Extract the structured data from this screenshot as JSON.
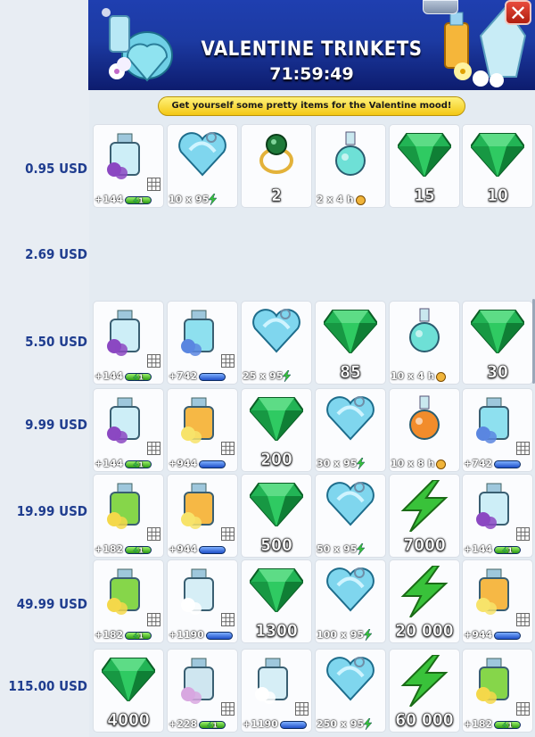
{
  "header": {
    "title": "VALENTINE TRINKETS",
    "timer": "71:59:49"
  },
  "banner": "Get yourself some pretty items for the Valentine mood!",
  "colors": {
    "header_blue": "#1f3fb0",
    "price_text": "#1f3d8f",
    "gem": "#22b455",
    "bolt": "#39c23a",
    "banner": "#f3c714"
  },
  "rows": [
    {
      "price": "0.95 USD",
      "items": [
        {
          "icon": "perfume-bouquet-icon",
          "label": "+144",
          "kind": "sub",
          "badge": "green",
          "badge_text": "1"
        },
        {
          "icon": "heart-bottle-icon",
          "label": "10 x 95",
          "kind": "sub-bolt"
        },
        {
          "icon": "emerald-ring-icon",
          "label": "2",
          "kind": "amt"
        },
        {
          "icon": "potion-flask-icon",
          "label": "2 x 4 h",
          "kind": "sub-clock"
        },
        {
          "icon": "emerald-gem-icon",
          "label": "15",
          "kind": "amt"
        },
        {
          "icon": "emerald-gem-icon",
          "label": "10",
          "kind": "amt"
        }
      ]
    },
    {
      "price": "2.69 USD",
      "items": []
    },
    {
      "price": "5.50 USD",
      "items": [
        {
          "icon": "perfume-bouquet-icon",
          "label": "+144",
          "kind": "sub",
          "badge": "green",
          "badge_text": "1"
        },
        {
          "icon": "heart-perfume-icon",
          "label": "+742",
          "kind": "sub",
          "badge": "blue"
        },
        {
          "icon": "heart-bottle-icon",
          "label": "25 x 95",
          "kind": "sub-bolt"
        },
        {
          "icon": "emerald-gem-icon",
          "label": "85",
          "kind": "amt"
        },
        {
          "icon": "potion-flask-icon",
          "label": "10 x 4 h",
          "kind": "sub-clock"
        },
        {
          "icon": "emerald-gem-icon",
          "label": "30",
          "kind": "amt"
        }
      ]
    },
    {
      "price": "9.99 USD",
      "items": [
        {
          "icon": "perfume-bouquet-icon",
          "label": "+144",
          "kind": "sub",
          "badge": "green",
          "badge_text": "1"
        },
        {
          "icon": "orange-perfume-icon",
          "label": "+944",
          "kind": "sub",
          "badge": "blue"
        },
        {
          "icon": "emerald-gem-icon",
          "label": "200",
          "kind": "amt"
        },
        {
          "icon": "heart-bottle-icon",
          "label": "30 x 95",
          "kind": "sub-bolt"
        },
        {
          "icon": "fire-potion-icon",
          "label": "10 x 8 h",
          "kind": "sub-clock"
        },
        {
          "icon": "heart-perfume-icon",
          "label": "+742",
          "kind": "sub",
          "badge": "blue"
        }
      ]
    },
    {
      "price": "19.99 USD",
      "items": [
        {
          "icon": "green-perfume-icon",
          "label": "+182",
          "kind": "sub",
          "badge": "green",
          "badge_text": "1"
        },
        {
          "icon": "orange-perfume-icon",
          "label": "+944",
          "kind": "sub",
          "badge": "blue"
        },
        {
          "icon": "emerald-gem-icon",
          "label": "500",
          "kind": "amt"
        },
        {
          "icon": "heart-bottle-icon",
          "label": "50 x 95",
          "kind": "sub-bolt"
        },
        {
          "icon": "lightning-bolt-icon",
          "label": "7000",
          "kind": "amt"
        },
        {
          "icon": "perfume-bouquet-icon",
          "label": "+144",
          "kind": "sub",
          "badge": "green",
          "badge_text": "1"
        }
      ]
    },
    {
      "price": "49.99 USD",
      "items": [
        {
          "icon": "green-perfume-icon",
          "label": "+182",
          "kind": "sub",
          "badge": "green",
          "badge_text": "1"
        },
        {
          "icon": "crystal-perfume-icon",
          "label": "+1190",
          "kind": "sub",
          "badge": "blue"
        },
        {
          "icon": "emerald-gem-icon",
          "label": "1300",
          "kind": "amt"
        },
        {
          "icon": "heart-bottle-icon",
          "label": "100 x 95",
          "kind": "sub-bolt"
        },
        {
          "icon": "lightning-bolt-icon",
          "label": "20 000",
          "kind": "amt"
        },
        {
          "icon": "orange-perfume-icon",
          "label": "+944",
          "kind": "sub",
          "badge": "blue"
        }
      ]
    },
    {
      "price": "115.00 USD",
      "items": [
        {
          "icon": "emerald-gem-icon",
          "label": "4000",
          "kind": "amt"
        },
        {
          "icon": "orchid-perfume-icon",
          "label": "+228",
          "kind": "sub",
          "badge": "green",
          "badge_text": "1"
        },
        {
          "icon": "crystal-perfume-icon",
          "label": "+1190",
          "kind": "sub",
          "badge": "blue"
        },
        {
          "icon": "heart-bottle-icon",
          "label": "250 x 95",
          "kind": "sub-bolt"
        },
        {
          "icon": "lightning-bolt-icon",
          "label": "60 000",
          "kind": "amt"
        },
        {
          "icon": "green-perfume-icon",
          "label": "+182",
          "kind": "sub",
          "badge": "green",
          "badge_text": "1"
        }
      ]
    }
  ]
}
